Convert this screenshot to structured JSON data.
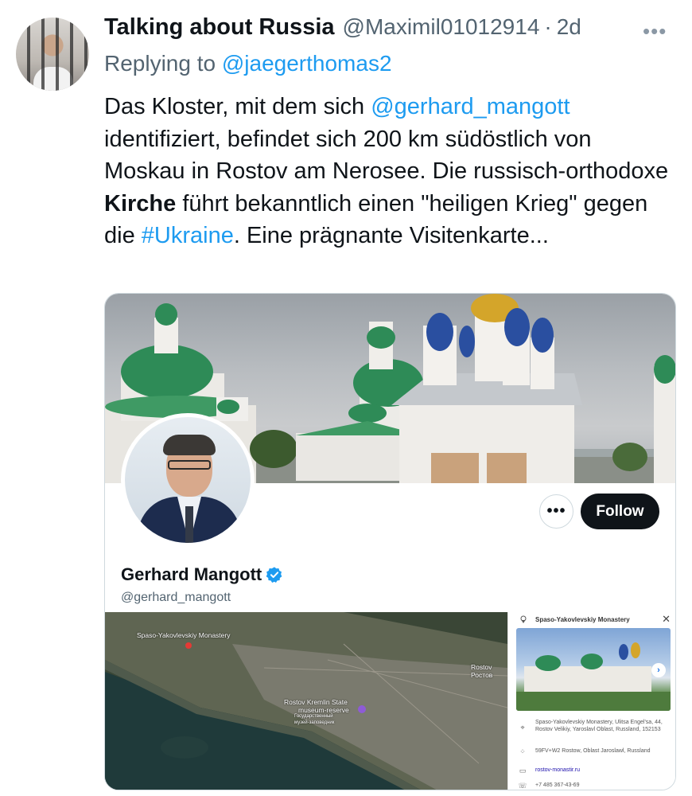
{
  "tweet": {
    "author_name": "Talking about Russia",
    "author_handle": "@Maximil01012914",
    "separator": "·",
    "time": "2d",
    "more_label": "•••",
    "reply_prefix": "Replying to ",
    "reply_to": "@jaegerthomas2",
    "text": {
      "p1": "Das Kloster, mit dem sich ",
      "mention": "@gerhard_mangott",
      "p2": " identifiziert, befindet sich 200 km südöstlich von Moskau in Rostov am Nerosee. Die russisch-orthodoxe ",
      "bold": "Kirche",
      "p3": " führt bekanntlich einen \"heiligen Krieg\" gegen die ",
      "hashtag": "#Ukraine",
      "p4": ". Eine prägnante Visitenkarte..."
    }
  },
  "profile_card": {
    "name": "Gerhard Mangott",
    "handle": "@gerhard_mangott",
    "more_label": "•••",
    "follow_label": "Follow",
    "verified": true,
    "accent": "#1d9bf0"
  },
  "map": {
    "labels": {
      "monastery": "Spaso-Yakovlevskiy Monastery",
      "rostov": "Rostov",
      "rostov_ru": "Ростов",
      "kremlin1": "Rostov Kremlin State",
      "kremlin2": "museum-reserve",
      "kremlin3": "Государственный",
      "kremlin4": "музей-заповедник"
    },
    "panel": {
      "title": "Spaso-Yakovlevskiy Monastery",
      "close": "✕",
      "address": "Spaso-Yakovlevskiy Monastery, Ulitsa Engel'sa, 44, Rostov Velikiy, Yaroslavl Oblast, Russland, 152153",
      "pluscode": "59FV+W2 Rostow, Oblast Jaroslawl, Russland",
      "website": "rostov-monastir.ru",
      "phone": "+7 485 367-43-69",
      "next_arrow": "›"
    }
  }
}
